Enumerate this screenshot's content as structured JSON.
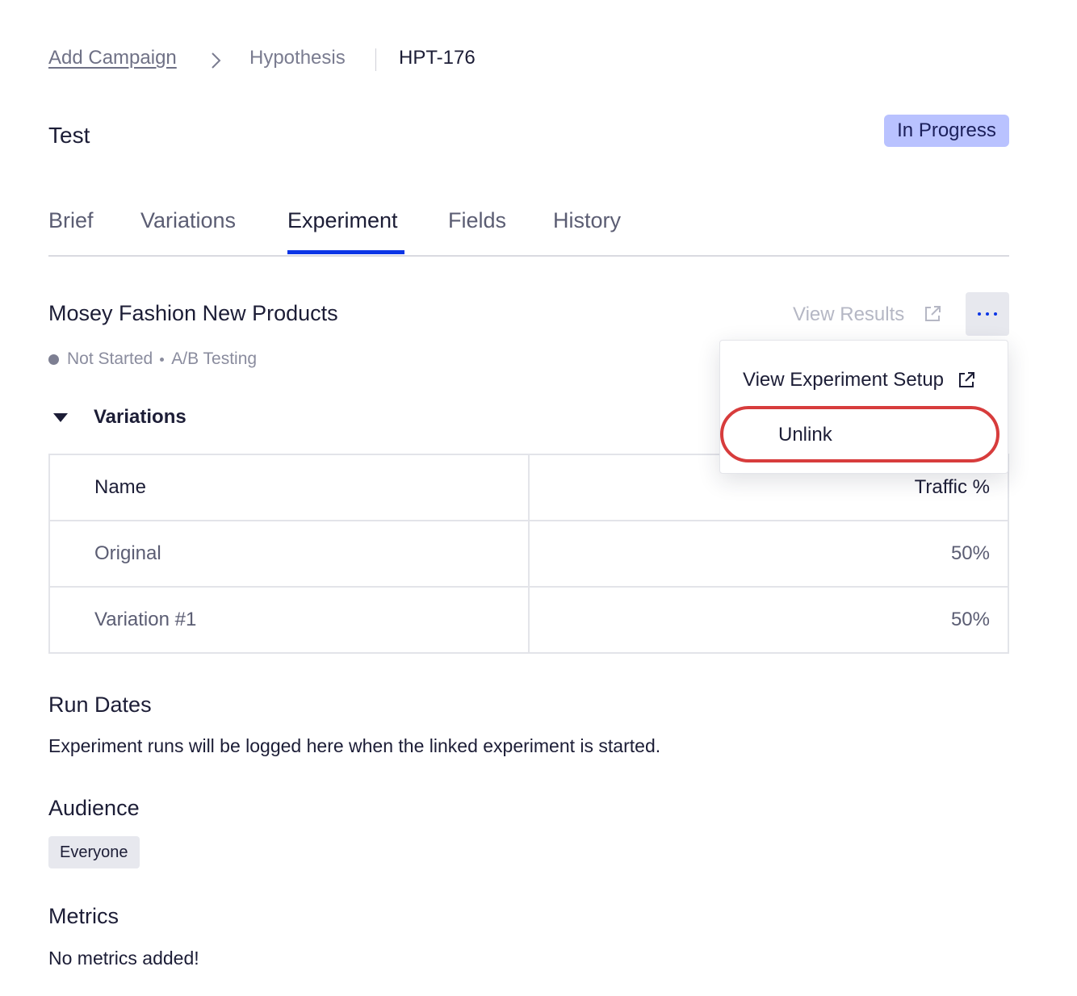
{
  "breadcrumb": {
    "link": "Add Campaign",
    "middle": "Hypothesis",
    "current": "HPT-176"
  },
  "page": {
    "title": "Test",
    "status": "In Progress"
  },
  "tabs": [
    {
      "label": "Brief"
    },
    {
      "label": "Variations"
    },
    {
      "label": "Experiment"
    },
    {
      "label": "Fields"
    },
    {
      "label": "History"
    }
  ],
  "active_tab": "Experiment",
  "experiment": {
    "name": "Mosey Fashion New Products",
    "view_results_label": "View Results",
    "state": "Not Started",
    "type": "A/B Testing",
    "variations_heading": "Variations",
    "table": {
      "headers": [
        "Name",
        "Traffic %"
      ],
      "rows": [
        [
          "Original",
          "50%"
        ],
        [
          "Variation #1",
          "50%"
        ]
      ]
    }
  },
  "menu": {
    "items": [
      {
        "label": "View Experiment Setup",
        "icon": "external-link-icon"
      },
      {
        "label": "Unlink"
      }
    ]
  },
  "run_dates": {
    "title": "Run Dates",
    "text": "Experiment runs will be logged here when the linked experiment is started."
  },
  "audience": {
    "title": "Audience",
    "tag": "Everyone"
  },
  "metrics": {
    "title": "Metrics",
    "text": "No metrics added!"
  },
  "colors": {
    "accent": "#0b35e6",
    "badge_bg": "#b9c2ff",
    "highlight": "#d73c3c"
  }
}
